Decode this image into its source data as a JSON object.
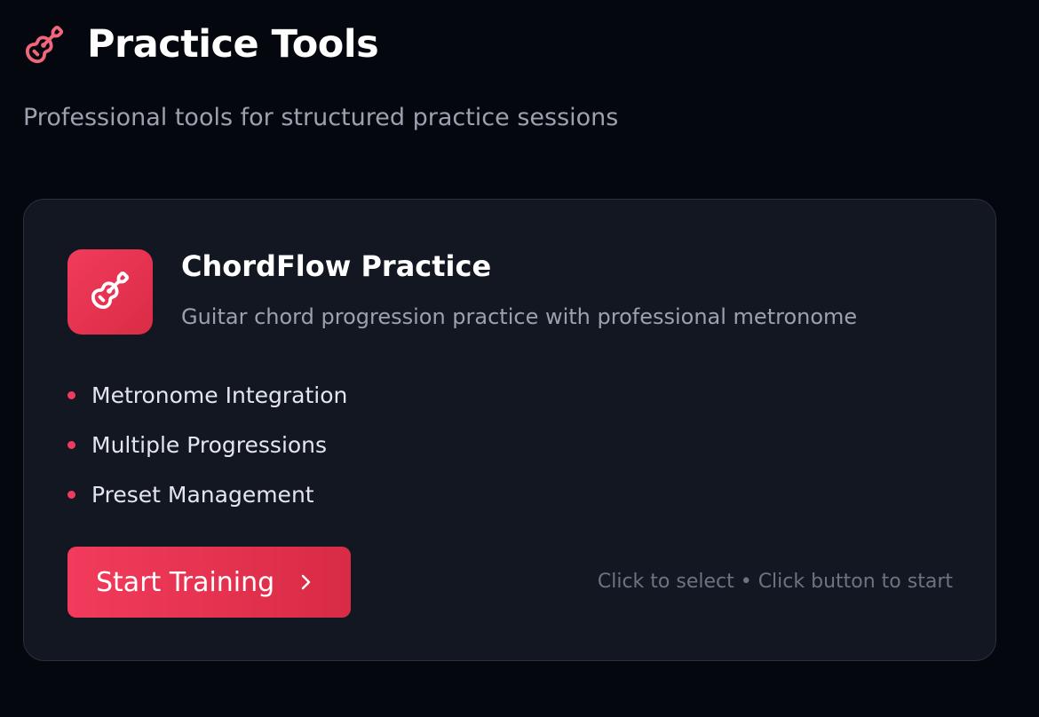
{
  "header": {
    "title": "Practice Tools",
    "icon": "guitar-icon",
    "icon_color": "#f2667c"
  },
  "subtitle": "Professional tools for structured practice sessions",
  "card": {
    "icon": "guitar-icon",
    "accent": "#f03d5e",
    "title": "ChordFlow Practice",
    "description": "Guitar chord progression practice with professional metronome",
    "features": [
      "Metronome Integration",
      "Multiple Progressions",
      "Preset Management"
    ],
    "button_label": "Start Training",
    "button_icon": "chevron-right-icon",
    "hint": "Click to select • Click button to start"
  }
}
